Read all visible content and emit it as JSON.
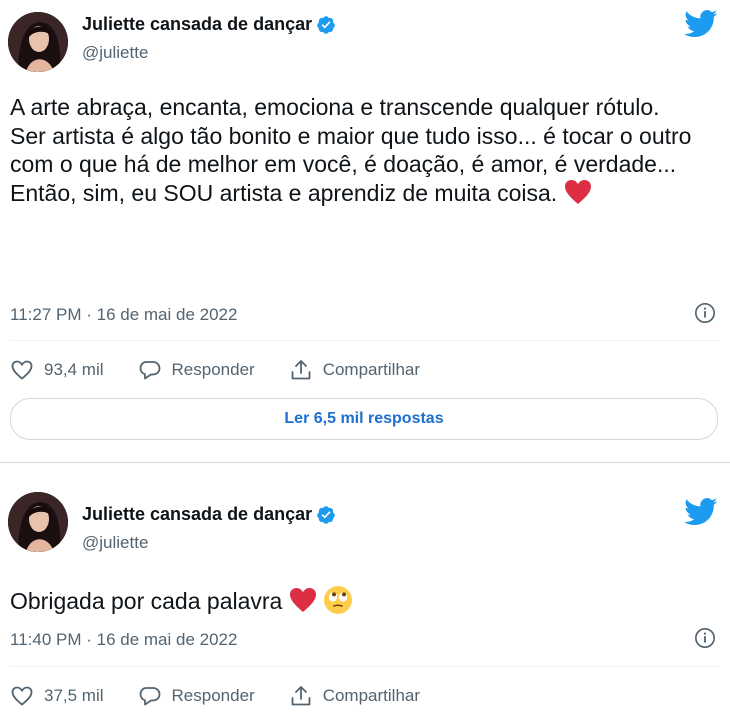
{
  "colors": {
    "accent": "#1d9bf0",
    "heart": "#e0245e",
    "muted": "#536471",
    "text": "#0f1419"
  },
  "tweets": [
    {
      "display_name": "Juliette cansada de dançar",
      "handle": "@juliette",
      "text_lines": [
        "A arte abraça, encanta, emociona e transcende qualquer rótulo.",
        "Ser artista é algo tão bonito e maior que tudo isso... é tocar o outro com o que há de melhor em você, é doação, é amor, é verdade...",
        "Então, sim, eu SOU artista e aprendiz de muita coisa."
      ],
      "emojis": [
        "red-heart"
      ],
      "timestamp": "11:27 PM · 16 de mai de 2022",
      "likes": "93,4 mil",
      "reply_label": "Responder",
      "share_label": "Compartilhar",
      "read_replies": "Ler 6,5 mil respostas"
    },
    {
      "display_name": "Juliette cansada de dançar",
      "handle": "@juliette",
      "text_lines": [
        "Obrigada por cada palavra"
      ],
      "emojis": [
        "red-heart",
        "face-with-rolling-eyes"
      ],
      "timestamp": "11:40 PM · 16 de mai de 2022",
      "likes": "37,5 mil",
      "reply_label": "Responder",
      "share_label": "Compartilhar"
    }
  ],
  "icons": [
    "avatar",
    "verified-badge-icon",
    "twitter-bird-icon",
    "info-icon",
    "heart-icon",
    "reply-icon",
    "share-icon"
  ]
}
